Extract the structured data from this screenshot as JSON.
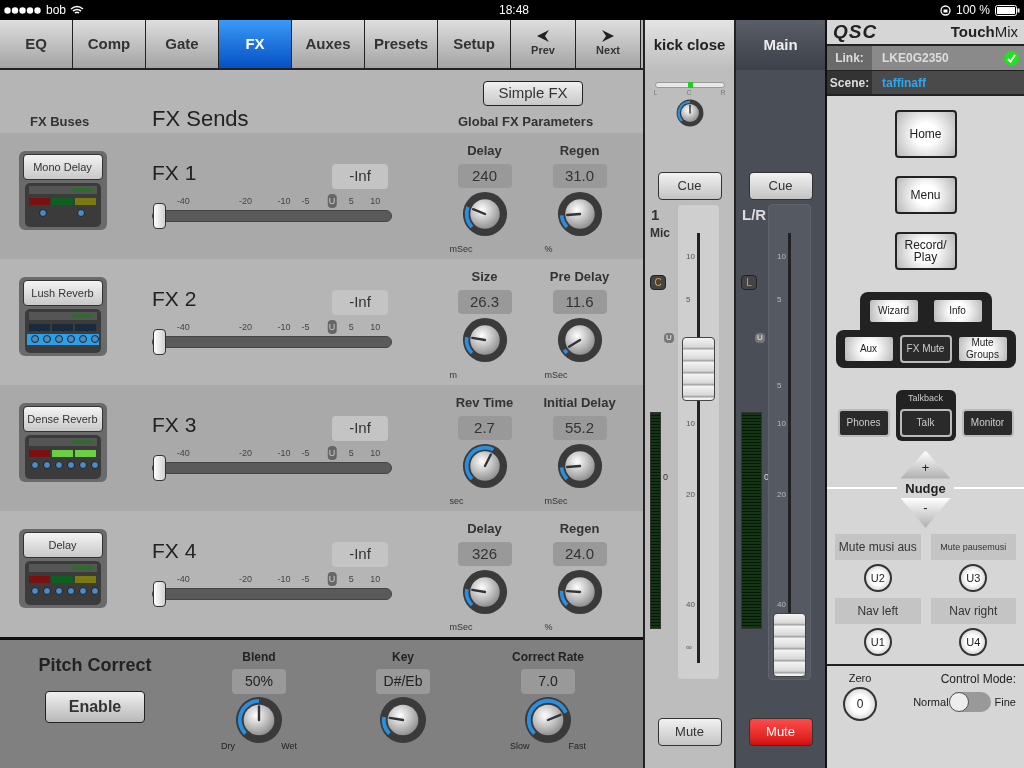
{
  "status_bar": {
    "carrier": "bob",
    "time": "18:48",
    "battery": "100 %"
  },
  "tabs": [
    {
      "label": "EQ",
      "selected": false,
      "kind": "text"
    },
    {
      "label": "Comp",
      "selected": false,
      "kind": "text"
    },
    {
      "label": "Gate",
      "selected": false,
      "kind": "text"
    },
    {
      "label": "FX",
      "selected": true,
      "kind": "text"
    },
    {
      "label": "Auxes",
      "selected": false,
      "kind": "text"
    },
    {
      "label": "Presets",
      "selected": false,
      "kind": "text"
    },
    {
      "label": "Setup",
      "selected": false,
      "kind": "text"
    },
    {
      "label": "Prev",
      "selected": false,
      "kind": "prev"
    },
    {
      "label": "Next",
      "selected": false,
      "kind": "next"
    }
  ],
  "simple_fx_button": "Simple FX",
  "headings": {
    "buses": "FX Buses",
    "sends": "FX Sends",
    "global": "Global FX Parameters"
  },
  "fx_rows": [
    {
      "bus": "Mono Delay",
      "kind": "delay",
      "name": "FX 1",
      "send": "-Inf",
      "level": 0,
      "scale": [
        "-40",
        "-20",
        "-10",
        "-5",
        "U",
        "5",
        "10"
      ],
      "params": [
        {
          "label": "Delay",
          "value": "240",
          "unit": "mSec"
        },
        {
          "label": "Regen",
          "value": "31.0",
          "unit": "%"
        }
      ]
    },
    {
      "bus": "Lush Reverb",
      "kind": "lush",
      "name": "FX 2",
      "send": "-Inf",
      "level": 0,
      "scale": [
        "-40",
        "-20",
        "-10",
        "-5",
        "U",
        "5",
        "10"
      ],
      "params": [
        {
          "label": "Size",
          "value": "26.3",
          "unit": "m"
        },
        {
          "label": "Pre Delay",
          "value": "11.6",
          "unit": "mSec"
        }
      ]
    },
    {
      "bus": "Dense Reverb",
      "kind": "dense",
      "name": "FX 3",
      "send": "-Inf",
      "level": 0,
      "scale": [
        "-40",
        "-20",
        "-10",
        "-5",
        "U",
        "5",
        "10"
      ],
      "params": [
        {
          "label": "Rev Time",
          "value": "2.7",
          "unit": "sec"
        },
        {
          "label": "Initial Delay",
          "value": "55.2",
          "unit": "mSec"
        }
      ]
    },
    {
      "bus": "Delay",
      "kind": "stereo_delay",
      "name": "FX 4",
      "send": "-Inf",
      "level": 0,
      "scale": [
        "-40",
        "-20",
        "-10",
        "-5",
        "U",
        "5",
        "10"
      ],
      "params": [
        {
          "label": "Delay",
          "value": "326",
          "unit": "mSec"
        },
        {
          "label": "Regen",
          "value": "24.0",
          "unit": "%"
        }
      ]
    }
  ],
  "pitch_correct": {
    "title": "Pitch Correct",
    "button": "Enable",
    "params": [
      {
        "label": "Blend",
        "value": "50%",
        "min": "Dry",
        "max": "Wet"
      },
      {
        "label": "Key",
        "value": "D#/Eb"
      },
      {
        "label": "Correct Rate",
        "value": "7.0",
        "min": "Slow",
        "max": "Fast"
      }
    ]
  },
  "strips": [
    {
      "kind": "channel",
      "header": "kick close",
      "pan_labels": [
        "L",
        "C",
        "R"
      ],
      "cue": "Cue",
      "number": "1",
      "name": "Mic",
      "badge": "C",
      "meter_zero": "0",
      "scale": [
        "10",
        "5",
        "U",
        "10",
        "20",
        "40",
        "∞"
      ],
      "level": 0.67,
      "mute": "Mute",
      "muted": false
    },
    {
      "kind": "main",
      "header": "Main",
      "cue": "Cue",
      "number": "L/R",
      "badge": "L",
      "meter_zero": "0",
      "scale": [
        "10",
        "5",
        "U",
        "5",
        "10",
        "20",
        "40"
      ],
      "level": 0,
      "mute": "Mute",
      "muted": true
    }
  ],
  "panel": {
    "logo": "QSC",
    "product": "**Touch**Mix",
    "link_label": "Link:",
    "link_value": "LKE0G2350",
    "linked": true,
    "scene_label": "Scene:",
    "scene_value": "taffinaff",
    "nav_buttons": [
      "Home",
      "Menu",
      "Record/ Play"
    ],
    "top_group": [
      "Wizard",
      "Info"
    ],
    "mid_group": [
      {
        "label": "Aux",
        "kind": "light"
      },
      {
        "label": "FX Mute",
        "kind": "dark"
      },
      {
        "label": "Mute Groups",
        "kind": "light"
      }
    ],
    "talkback_title": "Talkback",
    "talk_group": [
      "Phones",
      "Talk",
      "Monitor"
    ],
    "nudge": {
      "up": "+",
      "label": "Nudge",
      "down": "-"
    },
    "user_buttons": [
      {
        "caption": "Mute musi aus",
        "key": "U2",
        "small": false
      },
      {
        "caption": "Mute pausemusi",
        "key": "U3",
        "small": true
      },
      {
        "caption": "Nav left",
        "key": "U1",
        "small": false
      },
      {
        "caption": "Nav right",
        "key": "U4",
        "small": false
      }
    ],
    "zero_label": "Zero",
    "zero_button": "0",
    "mode_label": "Control Mode:",
    "mode_off": "Normal",
    "mode_on": "Fine",
    "fine": false
  }
}
